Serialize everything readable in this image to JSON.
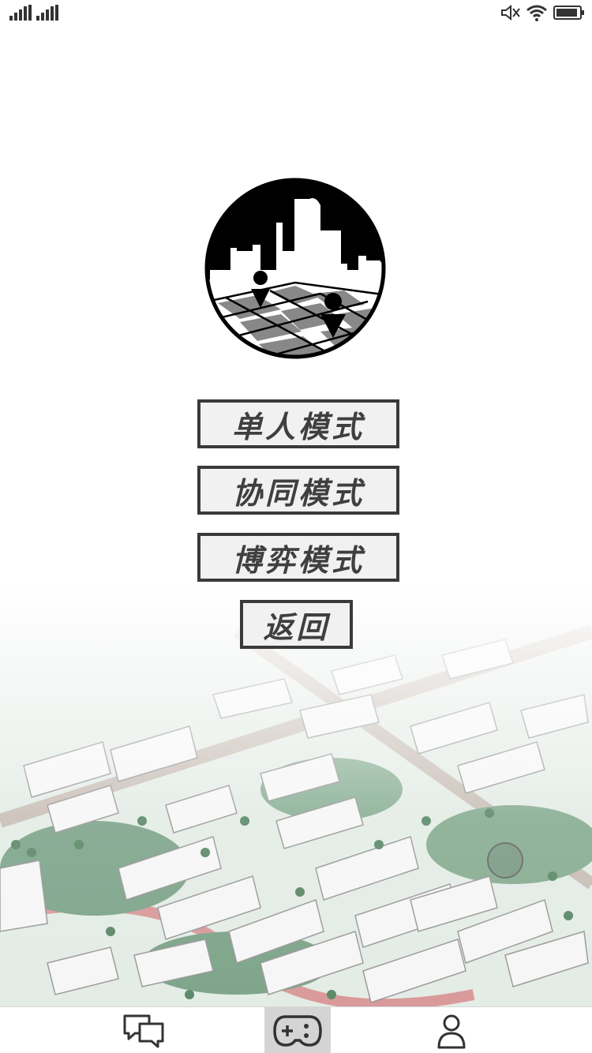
{
  "status_bar": {
    "signal_icon": "signal-bars-icon",
    "mute_icon": "volume-muted-icon",
    "wifi_icon": "wifi-icon",
    "battery_icon": "battery-icon"
  },
  "logo": {
    "icon": "city-chessboard-logo"
  },
  "menu": {
    "single_mode": "单人模式",
    "coop_mode": "协同模式",
    "game_mode": "博弈模式",
    "back": "返回"
  },
  "tab_bar": {
    "items": [
      {
        "icon": "chat-bubbles-icon",
        "selected": false
      },
      {
        "icon": "gamepad-icon",
        "selected": true
      },
      {
        "icon": "person-icon",
        "selected": false
      }
    ]
  },
  "colors": {
    "button_border": "#3a3a3a",
    "button_fill": "#f1f1f1",
    "button_text": "#3f3f3f",
    "selected_tab": "#d4d4d4"
  }
}
